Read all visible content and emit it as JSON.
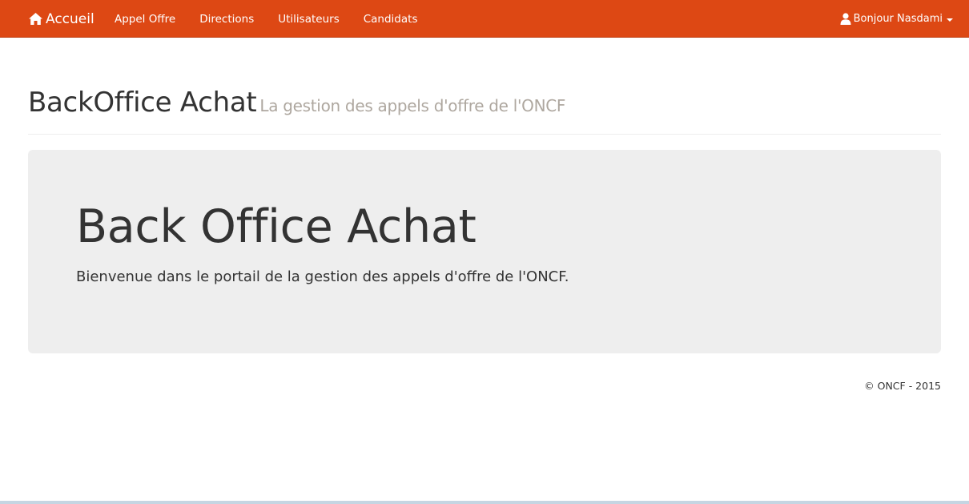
{
  "navbar": {
    "brand": {
      "label": "Accueil",
      "icon": "home-icon"
    },
    "items": [
      {
        "label": "Appel Offre"
      },
      {
        "label": "Directions"
      },
      {
        "label": "Utilisateurs"
      },
      {
        "label": "Candidats"
      }
    ],
    "user": {
      "label": "Bonjour Nasdami",
      "icon": "user-icon"
    }
  },
  "header": {
    "title": "BackOffice Achat",
    "subtitle": "La gestion des appels d'offre de l'ONCF"
  },
  "jumbotron": {
    "title": "Back Office Achat",
    "text": "Bienvenue dans le portail de la gestion des appels d'offre de l'ONCF."
  },
  "footer": {
    "copyright": "© ONCF - 2015"
  },
  "colors": {
    "navbar": "#dd4814",
    "jumbotron_bg": "#eeeeee",
    "subtitle": "#aea79f"
  }
}
